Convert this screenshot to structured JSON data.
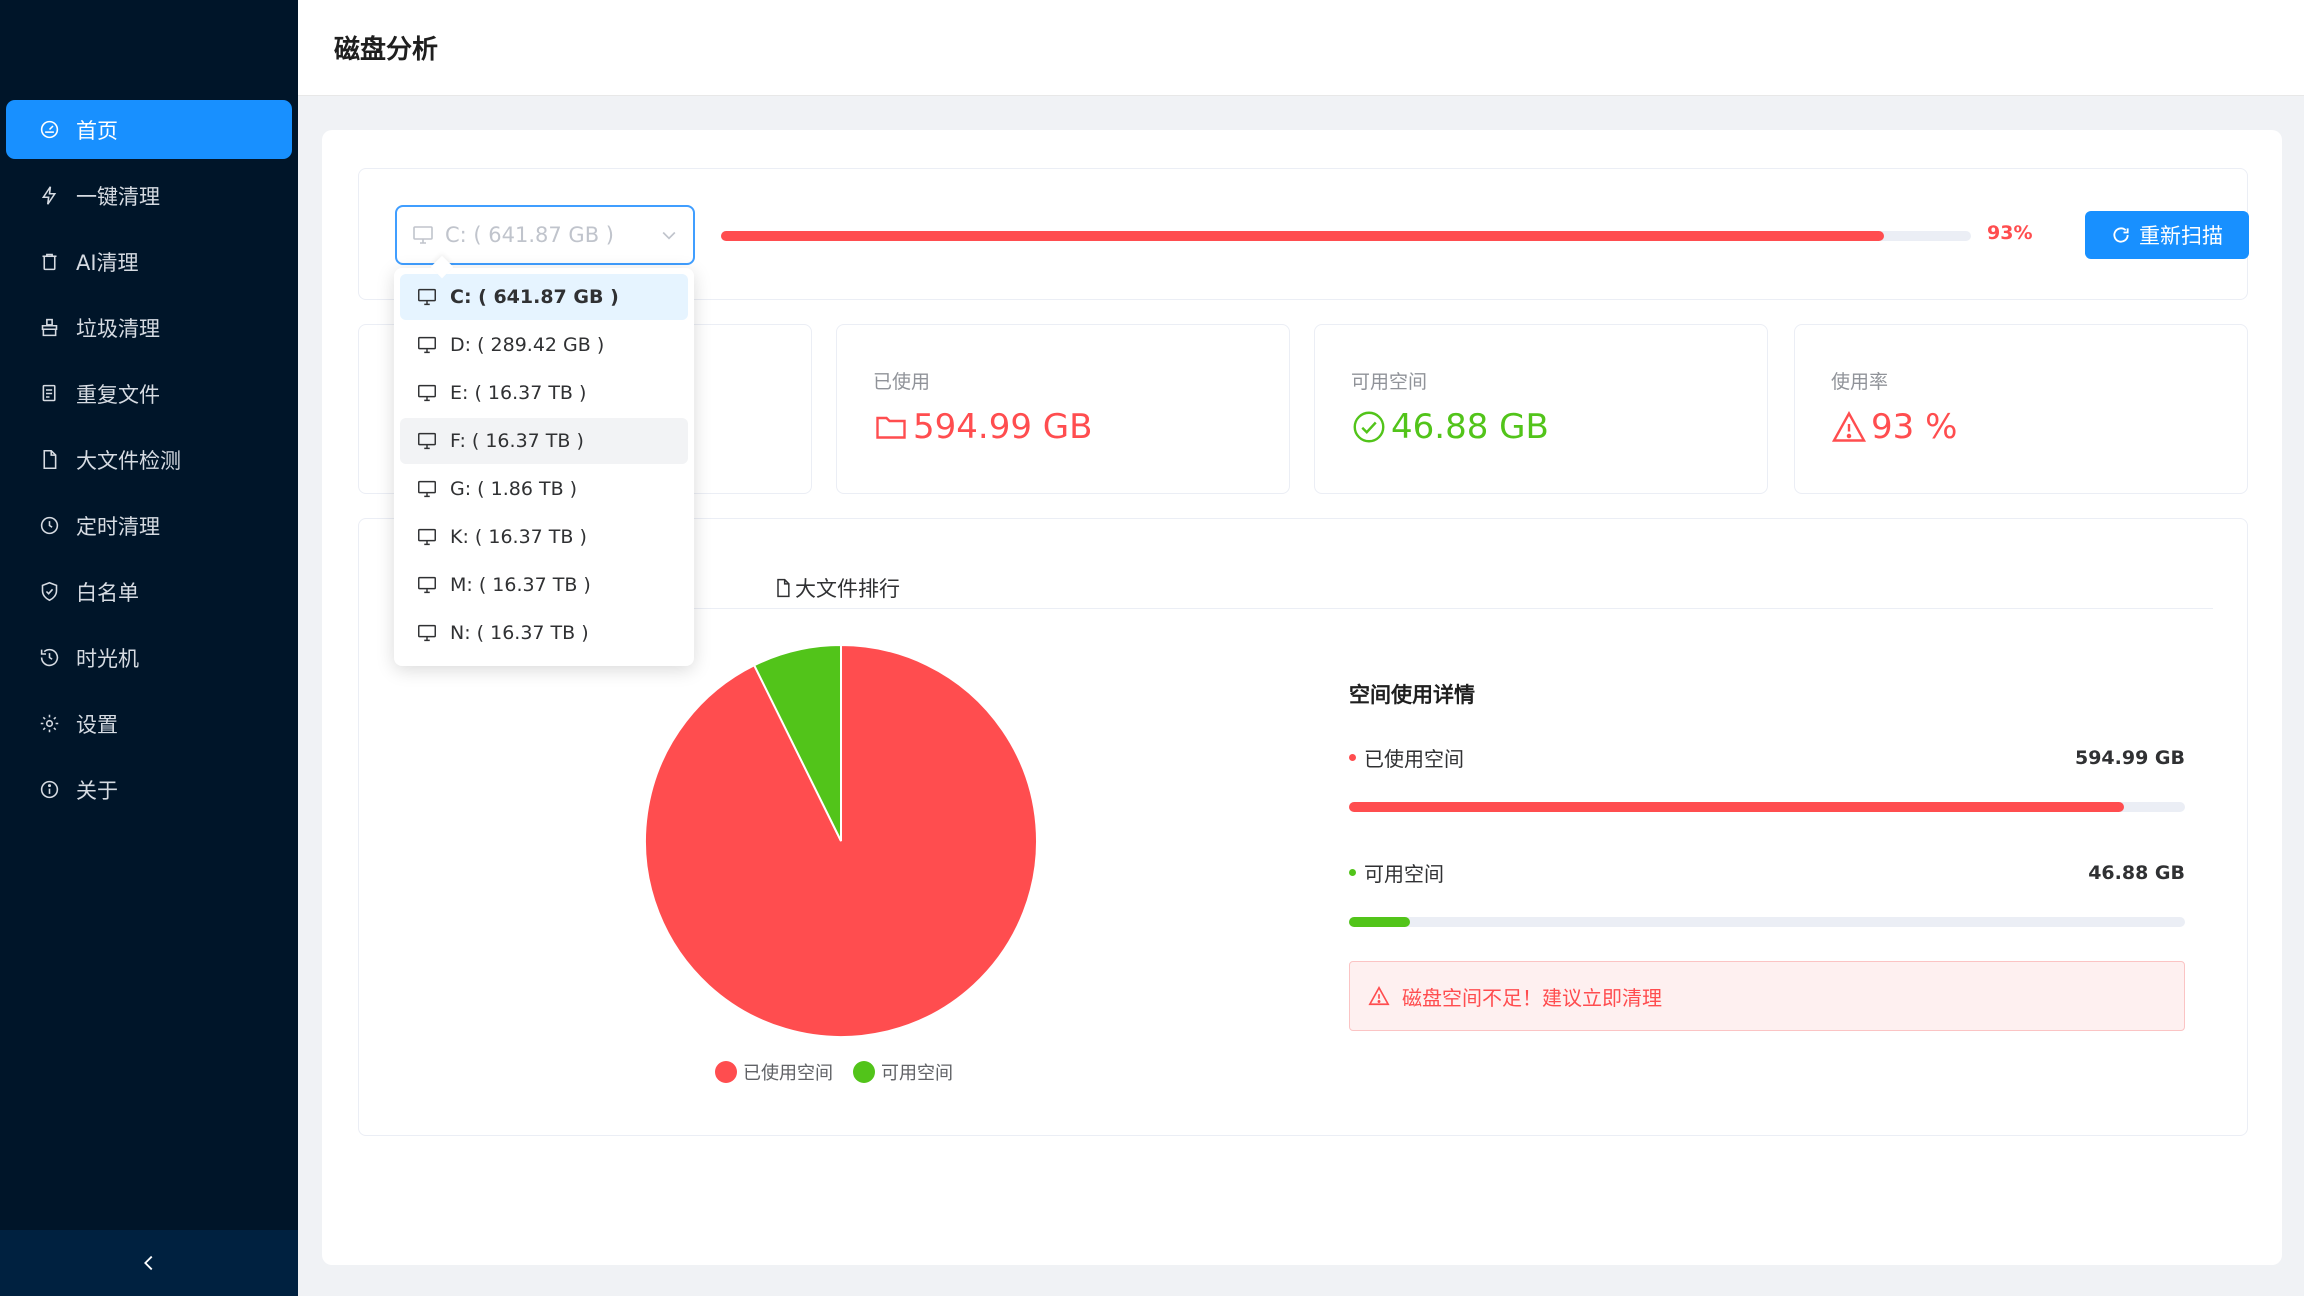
{
  "header": {
    "title": "磁盘分析"
  },
  "sidebar": {
    "items": [
      {
        "label": "首页",
        "icon": "dashboard-icon",
        "active": true
      },
      {
        "label": "一键清理",
        "icon": "lightning-icon",
        "active": false
      },
      {
        "label": "AI清理",
        "icon": "trash-icon",
        "active": false
      },
      {
        "label": "垃圾清理",
        "icon": "broom-icon",
        "active": false
      },
      {
        "label": "重复文件",
        "icon": "copy-icon",
        "active": false
      },
      {
        "label": "大文件检测",
        "icon": "file-icon",
        "active": false
      },
      {
        "label": "定时清理",
        "icon": "clock-icon",
        "active": false
      },
      {
        "label": "白名单",
        "icon": "shield-check-icon",
        "active": false
      },
      {
        "label": "时光机",
        "icon": "history-icon",
        "active": false
      },
      {
        "label": "设置",
        "icon": "gear-icon",
        "active": false
      },
      {
        "label": "关于",
        "icon": "info-icon",
        "active": false
      }
    ]
  },
  "scan": {
    "select_value": "C: ( 641.87 GB )",
    "usage_percent_value": 93,
    "usage_percent_text": "93%",
    "rescan_label": "重新扫描"
  },
  "dropdown": {
    "options": [
      {
        "label": "C: ( 641.87 GB )",
        "state": "selected"
      },
      {
        "label": "D: ( 289.42 GB )",
        "state": "normal"
      },
      {
        "label": "E: ( 16.37 TB )",
        "state": "normal"
      },
      {
        "label": "F: ( 16.37 TB )",
        "state": "hover"
      },
      {
        "label": "G: ( 1.86 TB )",
        "state": "normal"
      },
      {
        "label": "K: ( 16.37 TB )",
        "state": "normal"
      },
      {
        "label": "M: ( 16.37 TB )",
        "state": "normal"
      },
      {
        "label": "N: ( 16.37 TB )",
        "state": "normal"
      }
    ]
  },
  "stats": {
    "used": {
      "label": "已使用",
      "value": "594.99 GB",
      "icon": "folder-icon"
    },
    "free": {
      "label": "可用空间",
      "value": "46.88 GB",
      "icon": "check-circle-icon"
    },
    "rate": {
      "label": "使用率",
      "value": "93 %",
      "icon": "warning-icon"
    }
  },
  "tabs": {
    "large_files_label": "大文件排行"
  },
  "pie": {
    "used_percent": 92.7,
    "legend_used": "已使用空间",
    "legend_free": "可用空间"
  },
  "detail": {
    "title": "空间使用详情",
    "used_label": "已使用空间",
    "used_value": "594.99 GB",
    "used_percent": 92.7,
    "free_label": "可用空间",
    "free_value": "46.88 GB",
    "free_percent": 7.3,
    "alert": "磁盘空间不足！建议立即清理"
  },
  "colors": {
    "accent": "#1890ff",
    "danger": "#ff4d4f",
    "success": "#52c41a",
    "sidebar_bg": "#001529"
  }
}
